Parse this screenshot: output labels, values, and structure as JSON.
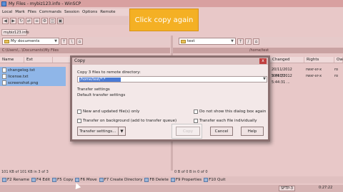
{
  "titlebar": {
    "text": "My Files - mybiz123.info - WinSCP"
  },
  "menubar": {
    "items": [
      "Local",
      "Mark",
      "Files",
      "Commands",
      "Session",
      "Options",
      "Remote"
    ]
  },
  "session_tab": "mybiz123.info",
  "left_pane": {
    "location": "My documents",
    "path": "C:\\Users\\...\\Documents\\My Files",
    "columns": [
      "Name",
      "Ext"
    ],
    "files": [
      {
        "name": "changelog.txt",
        "selected": true
      },
      {
        "name": "license.txt",
        "selected": true
      },
      {
        "name": "screenshot.png",
        "selected": true
      }
    ],
    "status": "101 KB of 101 KB in 3 of 3"
  },
  "right_pane": {
    "location": "test",
    "path": "/home/test",
    "columns": [
      "Changed",
      "Rights",
      "Ow"
    ],
    "rows": [
      {
        "changed": "20/11/2012 5:44:31 ...",
        "rights": "rwxr-xr-x",
        "owner": "ro"
      },
      {
        "changed": "20/11/2012 5:44:31 ...",
        "rights": "rwxr-xr-x",
        "owner": "ro"
      }
    ],
    "status": "0 B of 0 B in 0 of 0"
  },
  "callout": {
    "text": "Click copy again"
  },
  "dialog": {
    "title": "Copy",
    "close": "x",
    "label": "Copy 3 files to remote directory:",
    "target_value": "/home/test/*.*",
    "line1": "Transfer settings",
    "line2": "Default transfer settings",
    "checkbox_new": "New and updated file(s) only",
    "checkbox_background": "Transfer on background (add to transfer queue)",
    "checkbox_dontshow": "Do not show this dialog box again",
    "checkbox_individual": "Transfer each file individually",
    "btn_settings": "Transfer settings...",
    "btn_copy": "Copy",
    "btn_cancel": "Cancel",
    "btn_help": "Help"
  },
  "fkeys": [
    {
      "label": "F2 Rename"
    },
    {
      "label": "F4 Edit"
    },
    {
      "label": "F5 Copy"
    },
    {
      "label": "F6 Move"
    },
    {
      "label": "F7 Create Directory"
    },
    {
      "label": "F8 Delete"
    },
    {
      "label": "F9 Properties"
    },
    {
      "label": "F10 Quit"
    }
  ],
  "statusbar": {
    "protocol": "SFTP-3",
    "time": "0:27:22"
  },
  "icons": {
    "close": "close-icon",
    "folder": "folder-icon",
    "file": "file-icon",
    "cursor": "mouse-cursor-icon"
  },
  "colors": {
    "window_bg": "#e8c8c8",
    "callout": "#f4b024",
    "selection": "#4a7bd6"
  }
}
